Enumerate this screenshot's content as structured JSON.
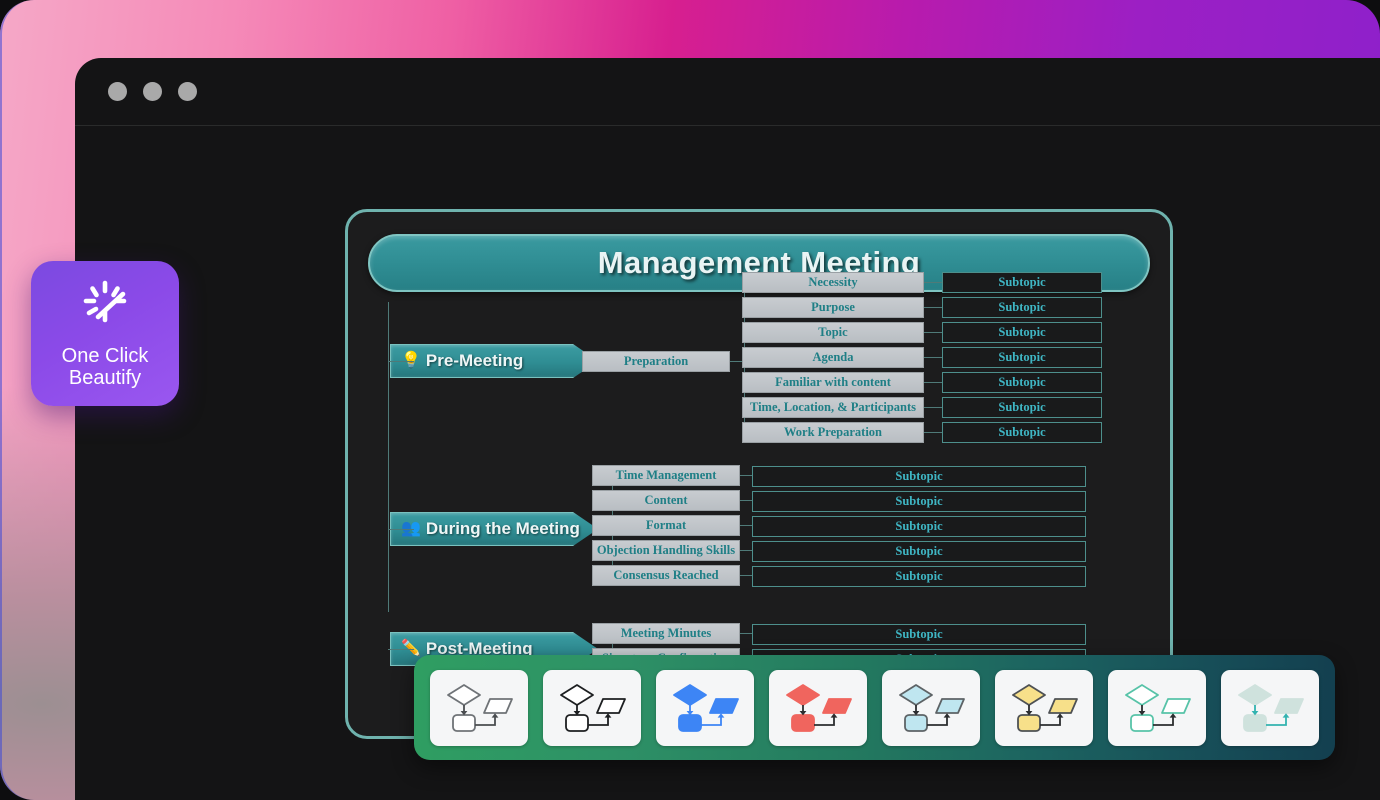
{
  "window": {
    "traffic_lights": [
      "close",
      "minimize",
      "maximize"
    ]
  },
  "beautify_badge": {
    "label": "One Click\nBeautify",
    "line1": "One Click",
    "line2": "Beautify",
    "icon": "magic-sparkle-icon",
    "color": "#8b4ae8"
  },
  "mindmap": {
    "root_title": "Management Meeting",
    "accent_color": "#2f8d93",
    "frame_border_color": "#6fb3ae",
    "subtopic_text_color": "#3fb6c4",
    "subtopic_default_label": "Subtopic",
    "branches": [
      {
        "id": "pre-meeting",
        "label": "Pre-Meeting",
        "emoji": "💡",
        "emoji_name": "lightbulb-icon",
        "mid": "Preparation",
        "topics": [
          "Necessity",
          "Purpose",
          "Topic",
          "Agenda",
          "Familiar with content",
          "Time, Location, & Participants",
          "Work Preparation"
        ]
      },
      {
        "id": "during-the-meeting",
        "label": "During the Meeting",
        "emoji": "👥",
        "emoji_name": "people-meeting-icon",
        "mid": null,
        "topics": [
          "Time Management",
          "Content",
          "Format",
          "Objection Handling Skills",
          "Consensus Reached"
        ]
      },
      {
        "id": "post-meeting",
        "label": "Post-Meeting",
        "emoji": "✏️",
        "emoji_name": "pencil-icon",
        "mid": null,
        "topics": [
          "Meeting Minutes",
          "Signature Confirmation"
        ]
      }
    ]
  },
  "theme_toolbar": {
    "themes": [
      {
        "name": "outline-gray",
        "fill": "#ffffff",
        "stroke": "#6f7377",
        "arrow": "#4a4d50"
      },
      {
        "name": "outline-black",
        "fill": "#ffffff",
        "stroke": "#1d1f21",
        "arrow": "#1d1f21"
      },
      {
        "name": "blue",
        "fill": "#3d85f5",
        "stroke": "#3d85f5",
        "arrow": "#3d85f5"
      },
      {
        "name": "red",
        "fill": "#f0655e",
        "stroke": "#f0655e",
        "arrow": "#2b2d2f"
      },
      {
        "name": "light-blue",
        "fill": "#bfe6f0",
        "stroke": "#5d6366",
        "arrow": "#2b2d2f"
      },
      {
        "name": "yellow",
        "fill": "#f7e08a",
        "stroke": "#4e5154",
        "arrow": "#2b2d2f"
      },
      {
        "name": "mint-outline",
        "fill": "#ffffff",
        "stroke": "#57c3a8",
        "arrow": "#2b2d2f"
      },
      {
        "name": "teal-muted",
        "fill": "#cfe2dd",
        "stroke": "#cfe2dd",
        "arrow": "#33b3b0"
      }
    ]
  }
}
